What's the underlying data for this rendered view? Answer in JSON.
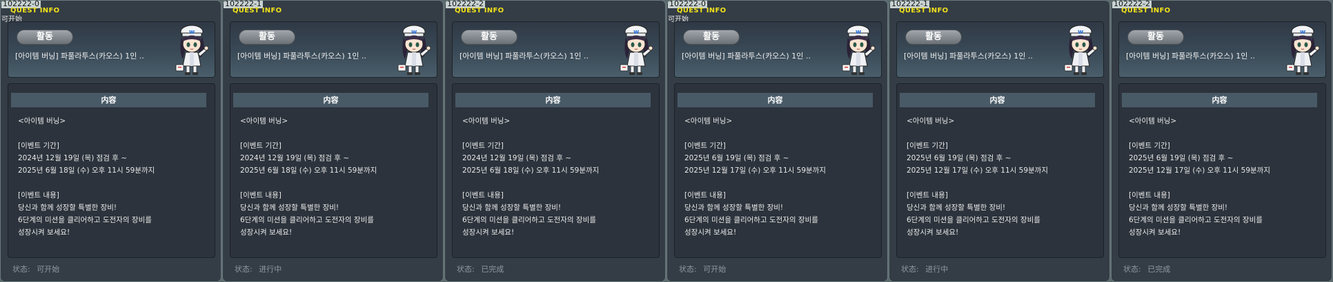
{
  "panels": [
    {
      "id": "102222-0",
      "quest_info_label": "QUEST INFO",
      "state_tag": "可开始",
      "activity_label": "활동",
      "quest_title": "[아이템 버닝] 파풀라투스(카오스) 1인 ..",
      "content_header": "内容",
      "content_text": "<아이템 버닝>\n\n[이벤트 기간]\n2024년 12월 19일 (목) 점검 후 ~\n2025년 6월 18일 (수) 오후 11시 59분까지\n\n[이벤트 내용]\n당신과 함께 성장할 특별한 장비!\n6단계의 미션을 클리어하고 도전자의 장비를\n성장시켜 보세요!",
      "status_label": "状态:",
      "status_value": "可开始"
    },
    {
      "id": "102222-1",
      "quest_info_label": "QUEST INFO",
      "state_tag": "",
      "activity_label": "활동",
      "quest_title": "[아이템 버닝] 파풀라투스(카오스) 1인 ..",
      "content_header": "内容",
      "content_text": "<아이템 버닝>\n\n[이벤트 기간]\n2024년 12월 19일 (목) 점검 후 ~\n2025년 6월 18일 (수) 오후 11시 59분까지\n\n[이벤트 내용]\n당신과 함께 성장할 특별한 장비!\n6단계의 미션을 클리어하고 도전자의 장비를\n성장시켜 보세요!",
      "status_label": "状态:",
      "status_value": "进行中"
    },
    {
      "id": "102222-2",
      "quest_info_label": "QUEST INFO",
      "state_tag": "",
      "activity_label": "활동",
      "quest_title": "[아이템 버닝] 파풀라투스(카오스) 1인 ..",
      "content_header": "内容",
      "content_text": "<아이템 버닝>\n\n[이벤트 기간]\n2024년 12월 19일 (목) 점검 후 ~\n2025년 6월 18일 (수) 오후 11시 59분까지\n\n[이벤트 내용]\n당신과 함께 성장할 특별한 장비!\n6단계의 미션을 클리어하고 도전자의 장비를\n성장시켜 보세요!",
      "status_label": "状态:",
      "status_value": "已完成"
    },
    {
      "id": "102222-0",
      "quest_info_label": "QUEST INFO",
      "state_tag": "可开始",
      "activity_label": "활동",
      "quest_title": "[아이템 버닝] 파풀라투스(카오스) 1인 ..",
      "content_header": "内容",
      "content_text": "<아이템 버닝>\n\n[이벤트 기간]\n2025년 6월 19일 (목) 점검 후 ~\n2025년 12월 17일 (수) 오후 11시 59분까지\n\n[이벤트 내용]\n당신과 함께 성장할 특별한 장비!\n6단계의 미션을 클리어하고 도전자의 장비를\n성장시켜 보세요!",
      "status_label": "状态:",
      "status_value": "可开始"
    },
    {
      "id": "102222-1",
      "quest_info_label": "QUEST INFO",
      "state_tag": "",
      "activity_label": "활동",
      "quest_title": "[아이템 버닝] 파풀라투스(카오스) 1인 ..",
      "content_header": "内容",
      "content_text": "<아이템 버닝>\n\n[이벤트 기간]\n2025년 6월 19일 (목) 점검 후 ~\n2025년 12월 17일 (수) 오후 11시 59분까지\n\n[이벤트 내용]\n당신과 함께 성장할 특별한 장비!\n6단계의 미션을 클리어하고 도전자의 장비를\n성장시켜 보세요!",
      "status_label": "状态:",
      "status_value": "进行中"
    },
    {
      "id": "102222-2",
      "quest_info_label": "QUEST INFO",
      "state_tag": "",
      "activity_label": "활동",
      "quest_title": "[아이템 버닝] 파풀라투스(카오스) 1인 ..",
      "content_header": "内容",
      "content_text": "<아이템 버닝>\n\n[이벤트 기간]\n2025년 6월 19일 (목) 점검 후 ~\n2025년 12월 17일 (수) 오후 11시 59분까지\n\n[이벤트 내용]\n당신과 함께 성장할 특별한 장비!\n6단계의 미션을 클리어하고 도전자의 장비를\n성장시켜 보세요!",
      "status_label": "状态:",
      "status_value": "已完成"
    }
  ],
  "icons": {
    "npc_portrait": "npc-nurse-icon"
  },
  "colors": {
    "quest_info_yellow": "#f2e21a",
    "panel_bg": "#343c45",
    "content_header_bg": "#485a66"
  }
}
